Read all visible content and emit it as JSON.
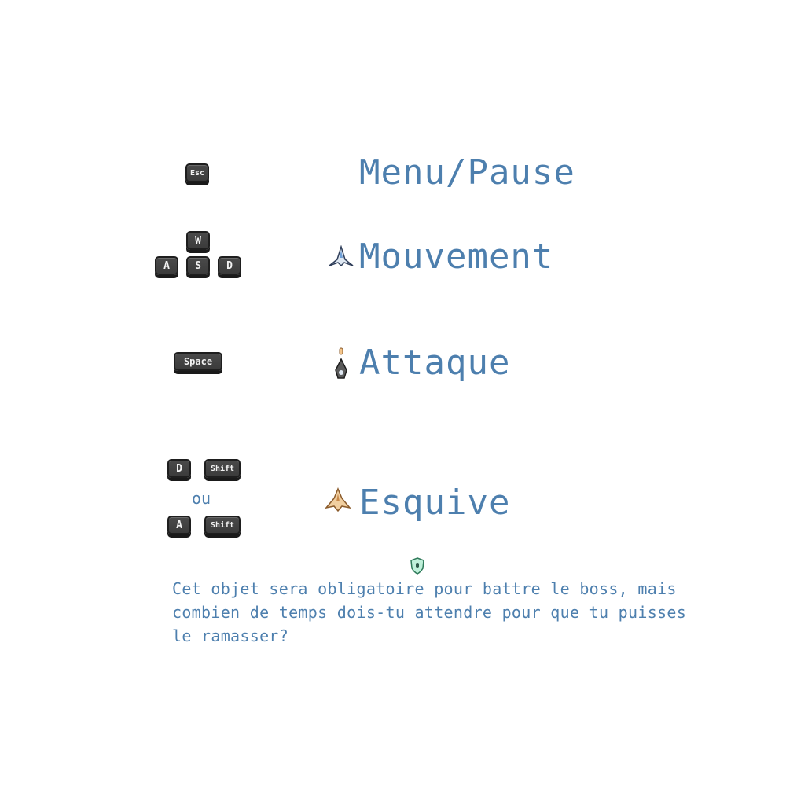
{
  "rows": {
    "menu": {
      "key": "Esc",
      "label": "Menu/Pause"
    },
    "movement": {
      "keys": [
        "W",
        "A",
        "S",
        "D"
      ],
      "label": "Mouvement",
      "icon": "ship-icon"
    },
    "attack": {
      "key": "Space",
      "label": "Attaque",
      "icon": "ship-firing-icon"
    },
    "dodge": {
      "combo1": [
        "D",
        "Shift"
      ],
      "separator": "ou",
      "combo2": [
        "A",
        "Shift"
      ],
      "label": "Esquive",
      "icon": "dodge-ship-icon"
    }
  },
  "item": {
    "icon": "shield-item-icon",
    "text": "Cet objet sera obligatoire pour battre le boss, mais combien de temps dois-tu attendre pour que tu puisses le ramasser?"
  },
  "colors": {
    "text": "#4d7fae",
    "key": "#3b3b3b",
    "item": "#6fcfa8"
  }
}
